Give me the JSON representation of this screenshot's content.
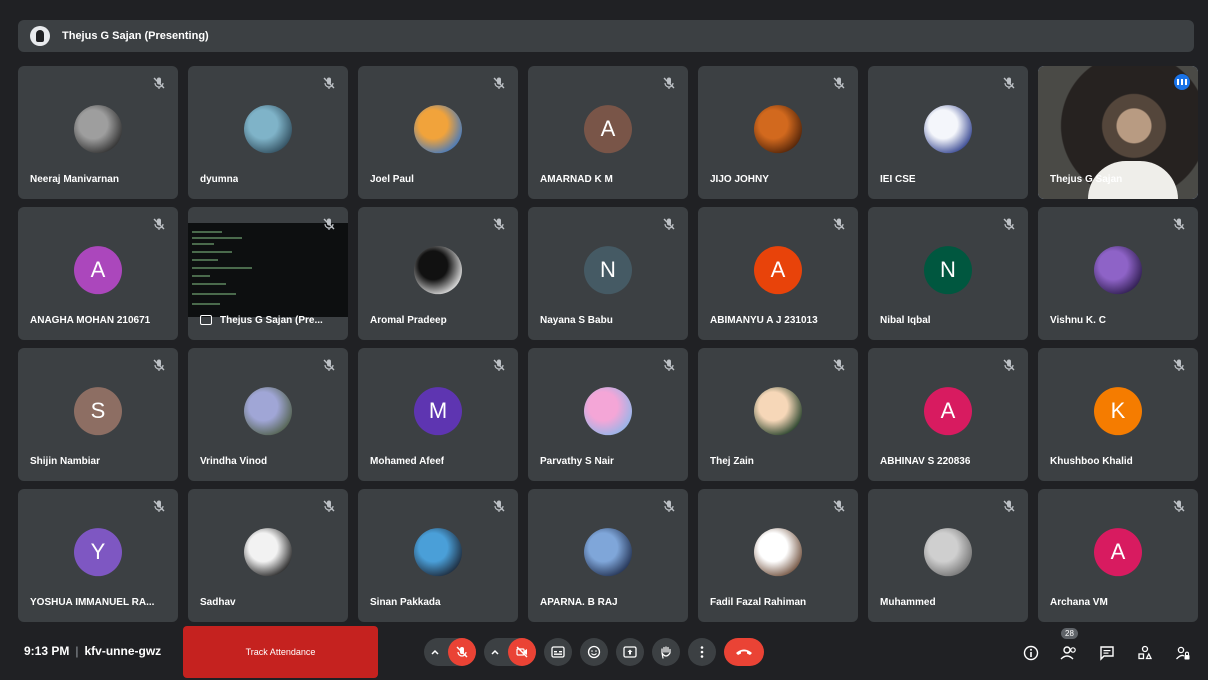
{
  "presenting_banner": "Thejus G Sajan (Presenting)",
  "participants": [
    {
      "name": "Neeraj Manivarnan",
      "avatar": "photo",
      "photo_colors": [
        "#9e9e9e",
        "#2b2b2b"
      ],
      "muted": true
    },
    {
      "name": "dyumna",
      "avatar": "photo",
      "photo_colors": [
        "#7fb3c8",
        "#2e4a5a"
      ],
      "muted": true
    },
    {
      "name": "Joel Paul",
      "avatar": "photo",
      "photo_colors": [
        "#f1a33b",
        "#3a77c6"
      ],
      "muted": true
    },
    {
      "name": "AMARNAD K M",
      "avatar": "letter",
      "letter": "A",
      "color": "#795548",
      "muted": true
    },
    {
      "name": "JIJO JOHNY",
      "avatar": "photo",
      "photo_colors": [
        "#d2691e",
        "#4a2008"
      ],
      "muted": true
    },
    {
      "name": "IEI CSE",
      "avatar": "photo",
      "photo_colors": [
        "#f4f6fb",
        "#2d3e8c"
      ],
      "muted": true
    },
    {
      "name": "Thejus G Sajan",
      "avatar": "video",
      "speaking": true,
      "muted": false
    },
    {
      "name": "ANAGHA MOHAN 210671",
      "avatar": "letter",
      "letter": "A",
      "color": "#ab47bc",
      "muted": true
    },
    {
      "name": "Thejus G Sajan (Pre...",
      "avatar": "screen",
      "muted": true
    },
    {
      "name": "Aromal Pradeep",
      "avatar": "photo",
      "photo_colors": [
        "#111111",
        "#f0f0f0"
      ],
      "muted": true
    },
    {
      "name": "Nayana S Babu",
      "avatar": "letter",
      "letter": "N",
      "color": "#455a64",
      "muted": true
    },
    {
      "name": "ABIMANYU A J 231013",
      "avatar": "letter",
      "letter": "A",
      "color": "#e8430a",
      "muted": true
    },
    {
      "name": "Nibal Iqbal",
      "avatar": "letter",
      "letter": "N",
      "color": "#00573f",
      "muted": true
    },
    {
      "name": "Vishnu K. C",
      "avatar": "photo",
      "photo_colors": [
        "#8e63c7",
        "#2a1a4a"
      ],
      "muted": true
    },
    {
      "name": "Shijin Nambiar",
      "avatar": "letter",
      "letter": "S",
      "color": "#8d6e63",
      "muted": true
    },
    {
      "name": "Vrindha Vinod",
      "avatar": "photo",
      "photo_colors": [
        "#a0a6d6",
        "#4f5f48"
      ],
      "muted": true
    },
    {
      "name": "Mohamed Afeef",
      "avatar": "letter",
      "letter": "M",
      "color": "#5e35b1",
      "muted": true
    },
    {
      "name": "Parvathy S Nair",
      "avatar": "photo",
      "photo_colors": [
        "#f4a6d7",
        "#8fb6ea"
      ],
      "muted": true
    },
    {
      "name": "Thej Zain",
      "avatar": "photo",
      "photo_colors": [
        "#f6d7b8",
        "#1c3b24"
      ],
      "muted": true
    },
    {
      "name": "ABHINAV S 220836",
      "avatar": "letter",
      "letter": "A",
      "color": "#d81b60",
      "muted": true
    },
    {
      "name": "Khushboo Khalid",
      "avatar": "letter",
      "letter": "K",
      "color": "#f57c00",
      "muted": true
    },
    {
      "name": "YOSHUA IMMANUEL RA...",
      "avatar": "letter",
      "letter": "Y",
      "color": "#7e57c2",
      "muted": true
    },
    {
      "name": "Sadhav",
      "avatar": "photo",
      "photo_colors": [
        "#f2f2f2",
        "#1e1e1e"
      ],
      "muted": true
    },
    {
      "name": "Sinan Pakkada",
      "avatar": "photo",
      "photo_colors": [
        "#4a9fd8",
        "#1b2433"
      ],
      "muted": true
    },
    {
      "name": "APARNA. B RAJ",
      "avatar": "photo",
      "photo_colors": [
        "#7fa6d9",
        "#1f2d4d"
      ],
      "muted": true
    },
    {
      "name": "Fadil Fazal Rahiman",
      "avatar": "photo",
      "photo_colors": [
        "#ffffff",
        "#6b4a36"
      ],
      "muted": true
    },
    {
      "name": "Muhammed",
      "avatar": "photo",
      "photo_colors": [
        "#cfcfcf",
        "#6f6f6f"
      ],
      "muted": true
    },
    {
      "name": "Archana VM",
      "avatar": "letter",
      "letter": "A",
      "color": "#d81b60",
      "muted": true
    }
  ],
  "bottom_bar": {
    "time": "9:13 PM",
    "separator": "|",
    "meeting_code": "kfv-unne-gwz",
    "track_attendance": "Track Attendance",
    "participant_count": "28"
  },
  "icons": {
    "mic_toggle": "mic-off-icon",
    "camera_toggle": "camera-off-icon",
    "captions": "captions-icon",
    "emoji": "emoji-icon",
    "present": "present-screen-icon",
    "hand": "raise-hand-icon",
    "more": "more-options-icon",
    "hangup": "hangup-icon",
    "info": "info-icon",
    "people": "people-icon",
    "chat": "chat-icon",
    "activities": "activities-icon",
    "host_controls": "lock-person-icon"
  },
  "colors": {
    "background": "#202124",
    "tile": "#3c4043",
    "red": "#ea4335",
    "speaking_outline": "#8ab4f8"
  }
}
